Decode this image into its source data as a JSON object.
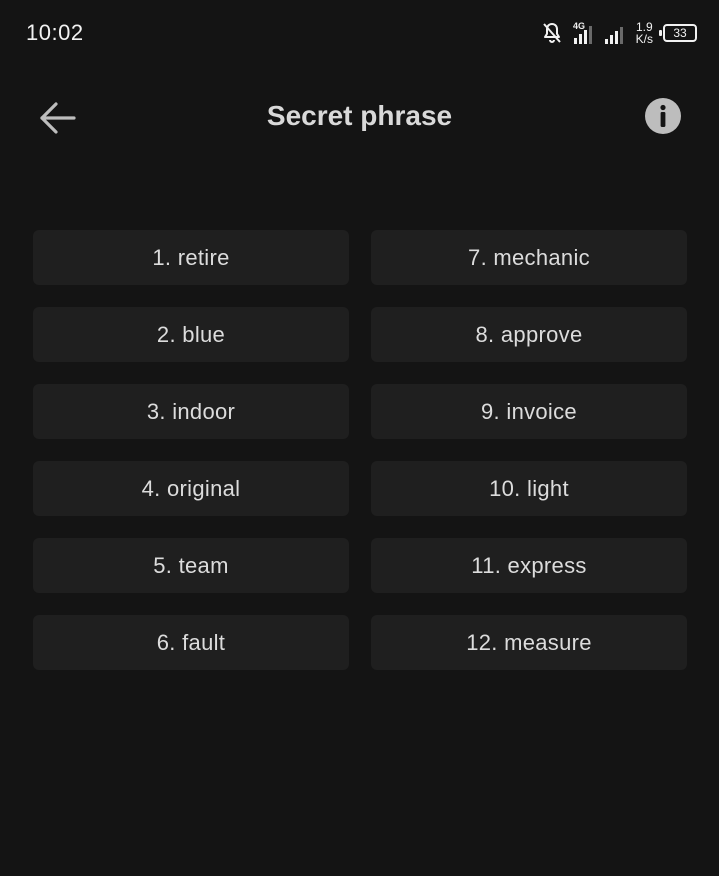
{
  "status_bar": {
    "time": "10:02",
    "network_label": "4G",
    "net_speed_value": "1.9",
    "net_speed_unit": "K/s",
    "battery_level": "33",
    "icons": [
      "bell-off-icon",
      "signal-4g-icon",
      "signal-bars-icon",
      "battery-icon"
    ]
  },
  "header": {
    "title": "Secret phrase",
    "back_icon": "arrow-left-icon",
    "info_icon": "info-icon"
  },
  "phrase": {
    "words": [
      "1. retire",
      "2. blue",
      "3. indoor",
      "4. original",
      "5. team",
      "6. fault",
      "7. mechanic",
      "8. approve",
      "9. invoice",
      "10. light",
      "11. express",
      "12. measure"
    ]
  },
  "colors": {
    "background": "#141414",
    "cell_background": "#1f1f1f",
    "text": "#dcdcdc",
    "icon": "#bdbdbd"
  }
}
